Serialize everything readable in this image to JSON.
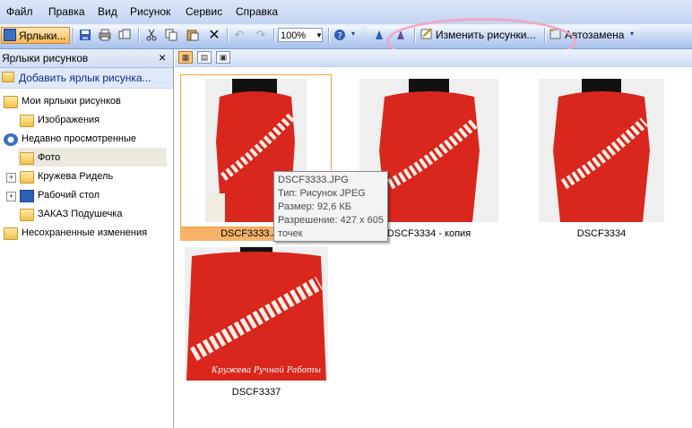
{
  "menu": [
    "Файл",
    "Правка",
    "Вид",
    "Рисунок",
    "Сервис",
    "Справка"
  ],
  "toolbar": {
    "shortcuts_label": "Ярлыки...",
    "zoom_value": "100%",
    "edit_pictures_label": "Изменить рисунки...",
    "autocorrect_label": "Автозамена"
  },
  "panel": {
    "title": "Ярлыки рисунков",
    "close": "×",
    "add_shortcut": "Добавить ярлык рисунка...",
    "tree": [
      {
        "label": "Мои ярлыки рисунков",
        "icon": "picture-folder-icon"
      },
      {
        "label": "Изображения",
        "icon": "picture-folder-icon"
      },
      {
        "label": "Недавно просмотренные",
        "icon": "recent-icon"
      },
      {
        "label": "Фото",
        "icon": "folder-icon",
        "selected": true
      },
      {
        "label": "Кружева Ридель",
        "icon": "folder-icon",
        "expander": "+"
      },
      {
        "label": "Рабочий стол",
        "icon": "desktop-icon",
        "expander": "+"
      },
      {
        "label": "ЗАКАЗ Подушечка",
        "icon": "folder-icon"
      },
      {
        "label": "Несохраненные изменения",
        "icon": "unsaved-icon"
      }
    ]
  },
  "thumbnails": [
    {
      "caption": "DSCF3333.JPG",
      "selected": true
    },
    {
      "caption": "DSCF3334 - копия"
    },
    {
      "caption": "DSCF3334"
    },
    {
      "caption": "DSCF3337"
    }
  ],
  "tooltip": {
    "name": "DSCF3333.JPG",
    "type": "Тип: Рисунок JPEG",
    "size": "Размер: 92,6 КБ",
    "resolution": "Разрешение: 427 x 605",
    "resolution_unit": "точек"
  },
  "watermark": "Кружева Ручной Работы",
  "colors": {
    "accent": "#f3a6c6",
    "dress": "#d9271e",
    "selection": "#f7b26a"
  }
}
